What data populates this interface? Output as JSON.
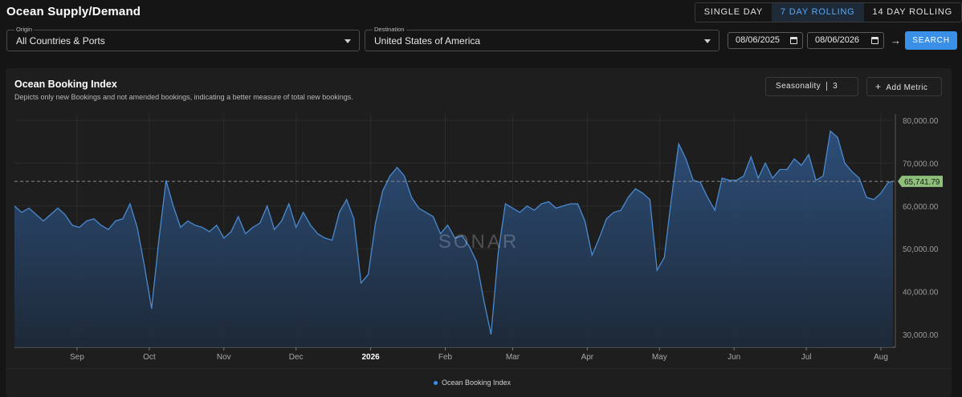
{
  "header": {
    "title": "Ocean Supply/Demand"
  },
  "view_toggle": {
    "options": [
      "SINGLE DAY",
      "7 DAY ROLLING",
      "14 DAY ROLLING"
    ],
    "active": "7 DAY ROLLING"
  },
  "filters": {
    "origin": {
      "label": "Origin",
      "value": "All Countries & Ports"
    },
    "destination": {
      "label": "Destination",
      "value": "United States of America"
    },
    "start_date": "08/06/2025",
    "end_date": "08/06/2026",
    "search_label": "SEARCH"
  },
  "panel": {
    "title": "Ocean Booking Index",
    "subtitle": "Depicts only new Bookings and not amended bookings, indicating a better measure of total new bookings.",
    "seasonality_label": "Seasonality",
    "seasonality_value": "3",
    "add_metric_label": "Add Metric",
    "watermark": "SONAR",
    "legend_label": "Ocean Booking Index"
  },
  "colors": {
    "accent": "#3a8fe6",
    "line": "#4a8ad0",
    "current_badge": "#8fc07a"
  },
  "chart_data": {
    "type": "area",
    "title": "",
    "xlabel": "",
    "ylabel": "",
    "ylim": [
      27000,
      81500
    ],
    "yticks": [
      30000,
      40000,
      50000,
      60000,
      70000,
      80000
    ],
    "ytick_labels": [
      "30,000.00",
      "40,000.00",
      "50,000.00",
      "60,000.00",
      "70,000.00",
      "80,000.00"
    ],
    "x_tick_labels": [
      "Sep",
      "Oct",
      "Nov",
      "Dec",
      "2026",
      "Feb",
      "Mar",
      "Apr",
      "May",
      "Jun",
      "Jul",
      "Aug"
    ],
    "x_tick_dates": [
      "2025-09-01",
      "2025-10-01",
      "2025-11-01",
      "2025-12-01",
      "2026-01-01",
      "2026-02-01",
      "2026-03-01",
      "2026-04-01",
      "2026-05-01",
      "2026-06-01",
      "2026-07-01",
      "2026-08-01"
    ],
    "current_value": 65741.79,
    "current_label": "65,741.79",
    "grid": true,
    "series": [
      {
        "name": "Ocean Booking Index",
        "x": [
          "2025-08-06",
          "2025-08-09",
          "2025-08-12",
          "2025-08-15",
          "2025-08-18",
          "2025-08-21",
          "2025-08-24",
          "2025-08-27",
          "2025-08-30",
          "2025-09-02",
          "2025-09-05",
          "2025-09-08",
          "2025-09-11",
          "2025-09-14",
          "2025-09-17",
          "2025-09-20",
          "2025-09-23",
          "2025-09-26",
          "2025-09-29",
          "2025-10-02",
          "2025-10-05",
          "2025-10-08",
          "2025-10-11",
          "2025-10-14",
          "2025-10-17",
          "2025-10-20",
          "2025-10-23",
          "2025-10-26",
          "2025-10-29",
          "2025-11-01",
          "2025-11-04",
          "2025-11-07",
          "2025-11-10",
          "2025-11-13",
          "2025-11-16",
          "2025-11-19",
          "2025-11-22",
          "2025-11-25",
          "2025-11-28",
          "2025-12-01",
          "2025-12-04",
          "2025-12-07",
          "2025-12-10",
          "2025-12-13",
          "2025-12-16",
          "2025-12-19",
          "2025-12-22",
          "2025-12-25",
          "2025-12-28",
          "2025-12-31",
          "2026-01-03",
          "2026-01-06",
          "2026-01-09",
          "2026-01-12",
          "2026-01-15",
          "2026-01-18",
          "2026-01-21",
          "2026-01-24",
          "2026-01-27",
          "2026-01-30",
          "2026-02-02",
          "2026-02-05",
          "2026-02-08",
          "2026-02-11",
          "2026-02-14",
          "2026-02-17",
          "2026-02-20",
          "2026-02-23",
          "2026-02-26",
          "2026-03-01",
          "2026-03-04",
          "2026-03-07",
          "2026-03-10",
          "2026-03-13",
          "2026-03-16",
          "2026-03-19",
          "2026-03-22",
          "2026-03-25",
          "2026-03-28",
          "2026-03-31",
          "2026-04-03",
          "2026-04-06",
          "2026-04-09",
          "2026-04-12",
          "2026-04-15",
          "2026-04-18",
          "2026-04-21",
          "2026-04-24",
          "2026-04-27",
          "2026-04-30",
          "2026-05-03",
          "2026-05-06",
          "2026-05-09",
          "2026-05-12",
          "2026-05-15",
          "2026-05-18",
          "2026-05-21",
          "2026-05-24",
          "2026-05-27",
          "2026-05-30",
          "2026-06-02",
          "2026-06-05",
          "2026-06-08",
          "2026-06-11",
          "2026-06-14",
          "2026-06-17",
          "2026-06-20",
          "2026-06-23",
          "2026-06-26",
          "2026-06-29",
          "2026-07-02",
          "2026-07-05",
          "2026-07-08",
          "2026-07-11",
          "2026-07-14",
          "2026-07-17",
          "2026-07-20",
          "2026-07-23",
          "2026-07-26",
          "2026-07-29",
          "2026-08-01",
          "2026-08-04",
          "2026-08-06"
        ],
        "values": [
          60000,
          58500,
          59500,
          58000,
          56500,
          58000,
          59500,
          58000,
          55500,
          55000,
          56500,
          57000,
          55500,
          54500,
          56500,
          57000,
          60500,
          55000,
          46000,
          36000,
          52000,
          66000,
          60000,
          55000,
          56500,
          55500,
          55000,
          54000,
          55500,
          52500,
          54000,
          57500,
          53500,
          55000,
          56000,
          60000,
          54500,
          56500,
          60500,
          55000,
          58500,
          55500,
          53500,
          52500,
          52000,
          58500,
          61500,
          57000,
          42000,
          44000,
          56000,
          63500,
          67000,
          69000,
          67000,
          62000,
          59500,
          58500,
          57500,
          53500,
          55500,
          52500,
          53000,
          50500,
          47000,
          38000,
          30000,
          49000,
          60500,
          59500,
          58500,
          60000,
          59000,
          60500,
          61000,
          59500,
          60000,
          60500,
          60500,
          56500,
          48500,
          52500,
          57000,
          58500,
          59000,
          62000,
          64000,
          63000,
          61500,
          45000,
          48000,
          62000,
          74500,
          71000,
          66000,
          65500,
          62000,
          59000,
          66500,
          66000,
          66000,
          67000,
          71500,
          66500,
          70000,
          66500,
          68500,
          68500,
          71000,
          69500,
          72000,
          66000,
          67000,
          77500,
          76000,
          70000,
          68000,
          66500,
          62000,
          61500,
          63000,
          65500,
          65741.79
        ]
      }
    ]
  }
}
